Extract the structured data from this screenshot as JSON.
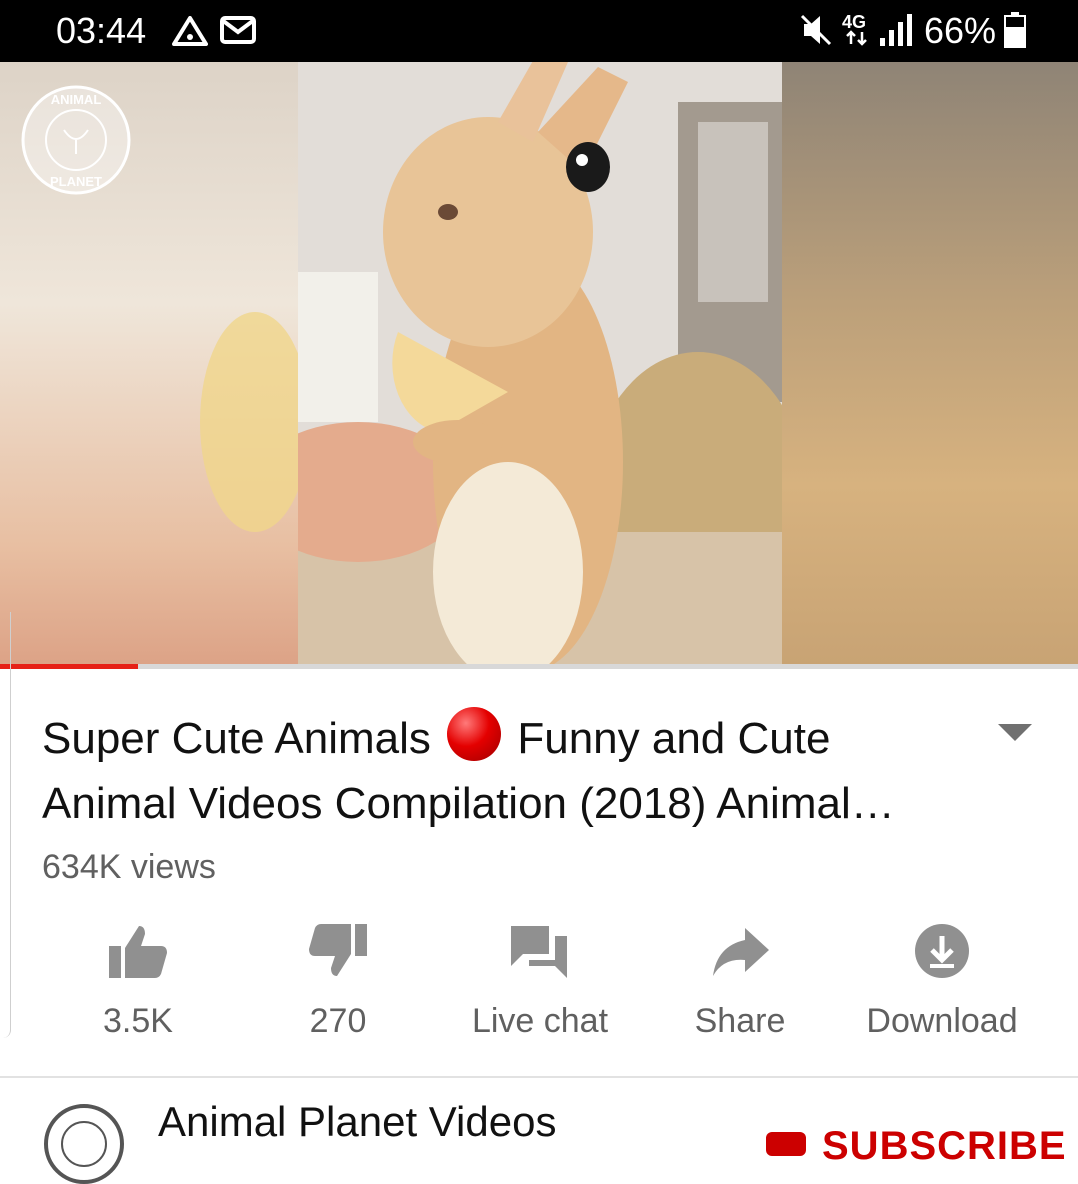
{
  "status_bar": {
    "time": "03:44",
    "battery": "66%",
    "network": "4G",
    "icons": [
      "alert-triangle-icon",
      "mail-icon",
      "mute-icon",
      "signal-icon",
      "battery-icon"
    ]
  },
  "video": {
    "watermark": "ANIMAL PLANET",
    "progress_percent": 12.8
  },
  "video_info": {
    "title": "Super Cute Animals 🔴 Funny and Cute Animal Videos Compilation (2018) Animal…",
    "title_part1": "Super Cute Animals",
    "title_part2": "Funny and Cute Animal Videos Compilation (2018) Animal…",
    "views": "634K views"
  },
  "actions": {
    "like": "3.5K",
    "dislike": "270",
    "live_chat": "Live chat",
    "share": "Share",
    "download": "Download"
  },
  "channel": {
    "name": "Animal Planet Videos",
    "subscribe_label": "SUBSCRIBE"
  },
  "colors": {
    "accent": "#e62117",
    "subscribe": "#cc0000",
    "icon_gray": "#909090"
  }
}
